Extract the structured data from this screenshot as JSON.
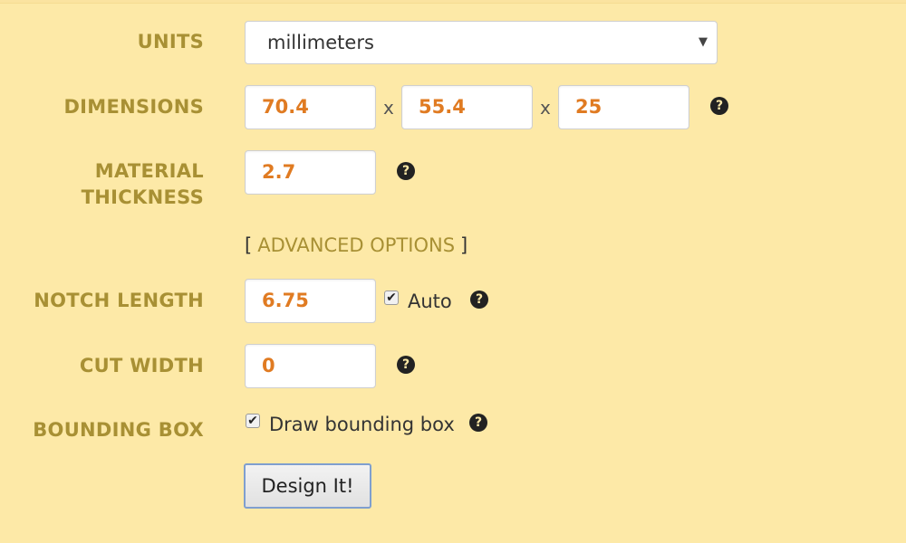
{
  "form": {
    "units": {
      "label": "UNITS",
      "value": "millimeters",
      "caret": "▼"
    },
    "dimensions": {
      "label": "DIMENSIONS",
      "width": "70.4",
      "depth": "55.4",
      "height": "25",
      "separator": "x"
    },
    "material_thickness": {
      "label_line1": "MATERIAL",
      "label_line2": "THICKNESS",
      "value": "2.7"
    },
    "advanced_options": {
      "open_bracket": "[",
      "link": "ADVANCED OPTIONS",
      "close_bracket": "]"
    },
    "notch_length": {
      "label": "NOTCH LENGTH",
      "value": "6.75",
      "auto_checked": true,
      "auto_label": "Auto"
    },
    "cut_width": {
      "label": "CUT WIDTH",
      "value": "0"
    },
    "bounding_box": {
      "label": "BOUNDING BOX",
      "checked": true,
      "checkbox_label": "Draw bounding box"
    },
    "submit": {
      "label": "Design It!"
    },
    "help_glyph": "?",
    "check_glyph": "✔"
  },
  "colors": {
    "background": "#fde9a7",
    "label": "#a89034",
    "value": "#e07b22"
  }
}
